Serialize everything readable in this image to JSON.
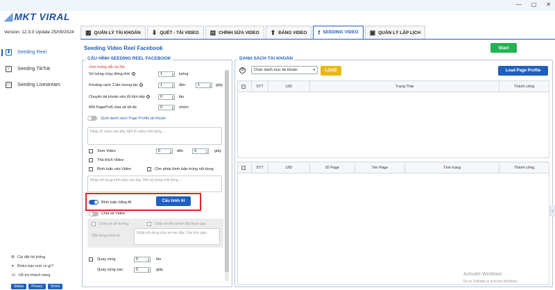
{
  "app": {
    "logo_text": "MKT VIRAL",
    "version_text": "Version: 12.3.0  Update 25/09/2024"
  },
  "window_controls": [
    "—",
    "▢",
    "✕"
  ],
  "tabs": [
    {
      "label": "QUẢN LÝ TÀI KHOẢN",
      "icon": "users-icon",
      "glyph": "▦"
    },
    {
      "label": "QUÉT - TẢI VIDEO",
      "icon": "download-icon",
      "glyph": "⬇"
    },
    {
      "label": "CHỈNH SỬA VIDEO",
      "icon": "film-icon",
      "glyph": "▤"
    },
    {
      "label": "ĐĂNG VIDEO",
      "icon": "upload-icon",
      "glyph": "⬆"
    },
    {
      "label": "SEEDING VIDEO",
      "icon": "facebook-icon",
      "glyph": "f"
    },
    {
      "label": "QUẢN LÝ LẬP LỊCH",
      "icon": "calendar-icon",
      "glyph": "▣"
    }
  ],
  "sidebar": {
    "items": [
      {
        "label": "Seeding Reel",
        "glyph": "▮"
      },
      {
        "label": "Seeding TikTok",
        "glyph": "♪"
      },
      {
        "label": "Seeding Livestream",
        "glyph": "▭"
      }
    ],
    "bottom": [
      {
        "label": "Cài đặt hệ thống",
        "glyph": "⚙"
      },
      {
        "label": "Phiên bản mới có gì?",
        "glyph": "✦"
      },
      {
        "label": "Hỗ trợ khách hàng",
        "glyph": "☏"
      }
    ],
    "footer_links": [
      "Status",
      "Privacy",
      "Terms"
    ]
  },
  "main": {
    "page_title": "Seeding Video Reel Facebook",
    "start_label": "Start",
    "config": {
      "legend": "CẤU HÌNH SEEDING REEL FACEBOOK",
      "hint": "Xem hướng dẫn tại đây",
      "rows": [
        {
          "label": "Số luồng chạy đồng thời",
          "value": "1",
          "unit": "luồng"
        },
        {
          "label": "Khoảng cách 2 lần tương tác",
          "value": "1",
          "to_label": "đến",
          "value2": "1",
          "unit": "giây"
        },
        {
          "label": "Chuyển tài khoản nếu lỗi liên tiếp",
          "value": "0",
          "unit": "lần"
        },
        {
          "label": "Mỗi PagePro5 chia sẻ tối đa",
          "value": "0",
          "unit": "nhóm"
        }
      ],
      "scan_profile_label": "Quét danh sách Page Profile tài khoản",
      "video_ids_placeholder": "Nhập ID video vào đây, Mỗi ID video một dòng ...",
      "watch_video_label": "Xem Video",
      "watch_from": "0",
      "watch_to_label": "đến",
      "watch_to": "0",
      "watch_unit": "giây",
      "like_video_label": "Thả thích Video",
      "comment_video_label": "Bình luận vào Video",
      "allow_reply_label": "Cho phép bình luận trùng nội dung",
      "comment_placeholder": "Nhập nội dung bình luận vào đây, Mỗi nội dung một dòng ...",
      "ai_comment_label": "Bình luận bằng AI",
      "ai_config_label": "Cấu hình AI",
      "share_video_label": "Chia sẻ Video",
      "share_wall_label": "Chia sẻ về tường",
      "share_group_label": "Chia sẻ lên nhóm đã tham gia",
      "share_content_label": "Nội dung chia sẻ",
      "share_content_placeholder": "Nhập nội dung chia sẻ vào đây, Cấu trúc spin...",
      "loop_label": "Quay vòng",
      "loop_value": "0",
      "loop_unit": "lần",
      "loop_after_label": "Quay vòng sau",
      "loop_after_value": "0",
      "loop_after_unit": "giây"
    },
    "accounts": {
      "legend": "DANH SÁCH TÀI KHOẢN",
      "select_value": "Chọn danh mục tài khoản",
      "load_label": "LOAD",
      "load_profile_label": "Load Page Profile",
      "table1_headers": [
        "STT",
        "UID",
        "Trạng Thái",
        "Thành công"
      ],
      "table2_headers": [
        "STT",
        "UID",
        "ID Page",
        "Tên Page",
        "Tình trạng",
        "Thành công"
      ]
    }
  },
  "watermark": {
    "title": "Activate Windows",
    "subtitle": "Go to Settings to activate Windows."
  },
  "colors": {
    "brand_blue": "#1f5fbf",
    "start_green": "#21b354",
    "load_yellow": "#e8b914",
    "highlight_red": "#e02424"
  }
}
